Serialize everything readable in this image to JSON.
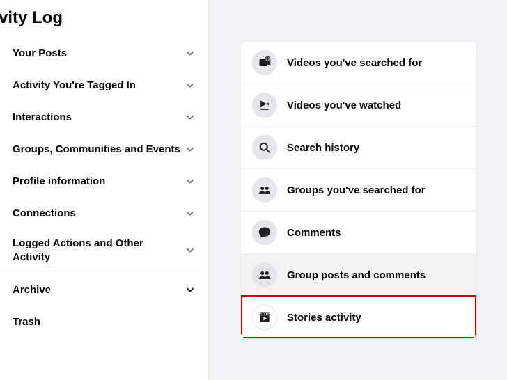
{
  "sidebar": {
    "title_part": "vity Log",
    "items": [
      {
        "label": "Your Posts"
      },
      {
        "label": "Activity You're Tagged In"
      },
      {
        "label": "Interactions"
      },
      {
        "label": "Groups, Communities and Events"
      },
      {
        "label": "Profile information"
      },
      {
        "label": "Connections"
      },
      {
        "label": "Logged Actions and Other Activity"
      }
    ],
    "archive": "Archive",
    "trash": "Trash"
  },
  "main": {
    "rows": [
      {
        "label": "Videos you've searched for",
        "icon": "video-search",
        "selected": false,
        "highlight": false
      },
      {
        "label": "Videos you've watched",
        "icon": "video-play",
        "selected": false,
        "highlight": false
      },
      {
        "label": "Search history",
        "icon": "search",
        "selected": false,
        "highlight": false
      },
      {
        "label": "Groups you've searched for",
        "icon": "groups",
        "selected": false,
        "highlight": false
      },
      {
        "label": "Comments",
        "icon": "comment",
        "selected": false,
        "highlight": false
      },
      {
        "label": "Group posts and comments",
        "icon": "groups",
        "selected": true,
        "highlight": false
      },
      {
        "label": "Stories activity",
        "icon": "stories",
        "selected": false,
        "highlight": true
      }
    ]
  }
}
